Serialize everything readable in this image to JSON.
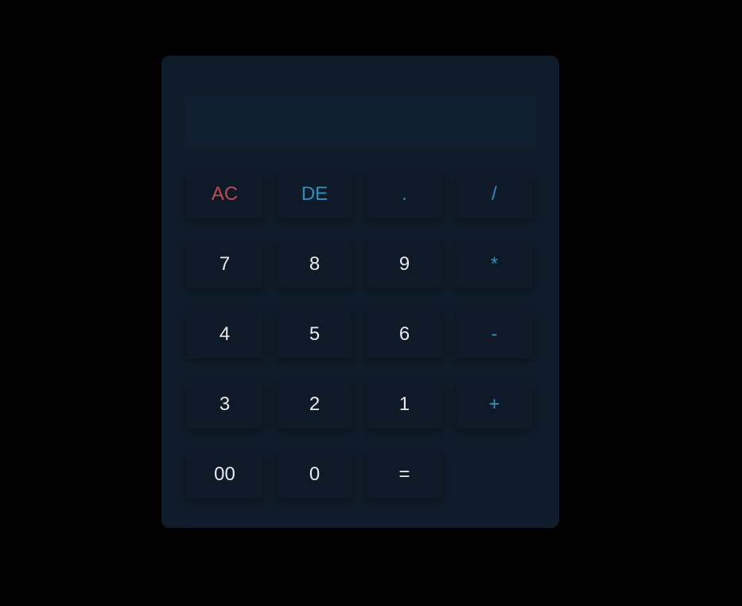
{
  "display": {
    "value": ""
  },
  "colors": {
    "background": "#000000",
    "body": "#0f1c2a",
    "key": "#0e1a27",
    "number_text": "#e8e8e8",
    "operator_text": "#2f8fbd",
    "clear_text": "#c04a55"
  },
  "keys": {
    "ac": "AC",
    "de": "DE",
    "dot": ".",
    "divide": "/",
    "seven": "7",
    "eight": "8",
    "nine": "9",
    "multiply": "*",
    "four": "4",
    "five": "5",
    "six": "6",
    "subtract": "-",
    "three": "3",
    "two": "2",
    "one": "1",
    "add": "+",
    "double_zero": "00",
    "zero": "0",
    "equals": "="
  }
}
